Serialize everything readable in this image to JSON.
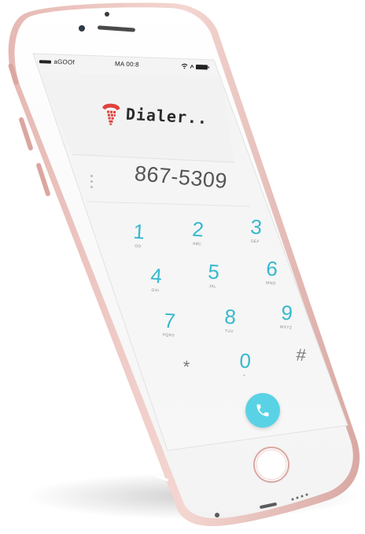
{
  "status_bar": {
    "carrier": "aGOOf",
    "time": "MA 00:8"
  },
  "header": {
    "app_name": "Dialer..",
    "logo_icon": "phone-tower-icon",
    "accent_color": "#e0413d"
  },
  "dial": {
    "number": "867-5309",
    "menu_icon": "vertical-dots-icon"
  },
  "keypad": {
    "keys": [
      {
        "digit": "1",
        "letters": "OO"
      },
      {
        "digit": "2",
        "letters": "ABC"
      },
      {
        "digit": "3",
        "letters": "DEF"
      },
      {
        "digit": "4",
        "letters": "GHI"
      },
      {
        "digit": "5",
        "letters": "JKL"
      },
      {
        "digit": "6",
        "letters": "MNO"
      },
      {
        "digit": "7",
        "letters": "PQRS"
      },
      {
        "digit": "8",
        "letters": "TUV"
      },
      {
        "digit": "9",
        "letters": "WXYZ"
      },
      {
        "digit": "*",
        "letters": ""
      },
      {
        "digit": "0",
        "letters": "+"
      },
      {
        "digit": "#",
        "letters": ""
      }
    ],
    "digit_color": "#37b9cf"
  },
  "call_button": {
    "icon": "phone-handset-icon",
    "color": "#5ad2e6"
  }
}
